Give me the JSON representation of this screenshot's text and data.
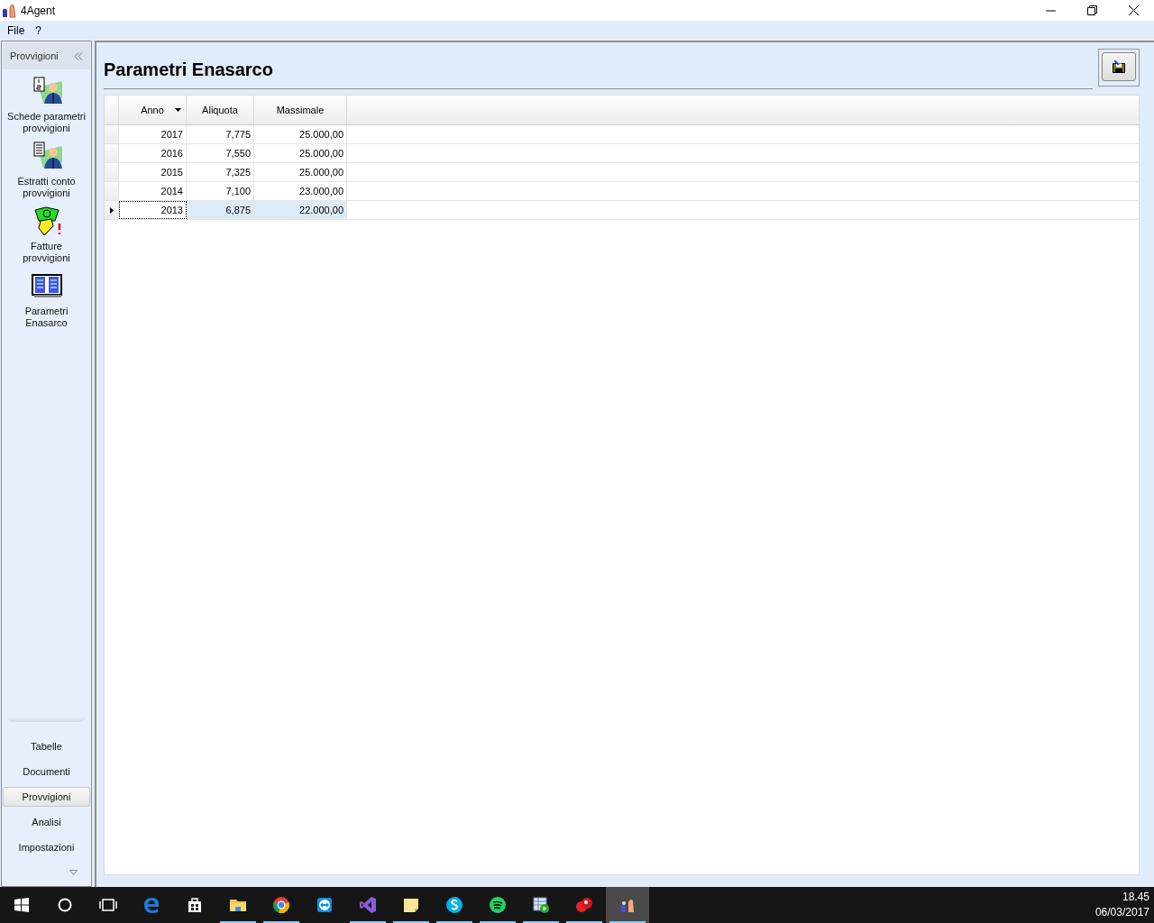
{
  "window": {
    "title": "4Agent"
  },
  "menu": [
    "File",
    "?"
  ],
  "sidebar": {
    "header": "Provvigioni",
    "items": [
      {
        "kind": "schede",
        "label": "Schede parametri provvigioni"
      },
      {
        "kind": "estratti",
        "label": "Estratti conto provvigioni"
      },
      {
        "kind": "fatture",
        "label": "Fatture provvigioni"
      },
      {
        "kind": "parametri",
        "label": "Parametri Enasarco"
      }
    ],
    "sections": [
      {
        "label": "Tabelle",
        "selected": false
      },
      {
        "label": "Documenti",
        "selected": false
      },
      {
        "label": "Provvigioni",
        "selected": true
      },
      {
        "label": "Analisi",
        "selected": false
      },
      {
        "label": "Impostazioni",
        "selected": false
      }
    ]
  },
  "page": {
    "title": "Parametri Enasarco"
  },
  "table": {
    "columns": [
      {
        "label": "Anno",
        "sorted": true
      },
      {
        "label": "Aliquota",
        "sorted": false
      },
      {
        "label": "Massimale",
        "sorted": false
      }
    ],
    "rows": [
      {
        "cells": [
          "2017",
          "7,775",
          "25.000,00"
        ],
        "selected": false
      },
      {
        "cells": [
          "2016",
          "7,550",
          "25.000,00"
        ],
        "selected": false
      },
      {
        "cells": [
          "2015",
          "7,325",
          "25.000,00"
        ],
        "selected": false
      },
      {
        "cells": [
          "2014",
          "7,100",
          "23.000,00"
        ],
        "selected": false
      },
      {
        "cells": [
          "2013",
          "6,875",
          "22.000,00"
        ],
        "selected": true
      }
    ]
  },
  "taskbar": {
    "apps": [
      {
        "kind": "windows",
        "running": false,
        "active": false
      },
      {
        "kind": "search",
        "running": false,
        "active": false
      },
      {
        "kind": "taskview",
        "running": false,
        "active": false
      },
      {
        "kind": "edge",
        "running": false,
        "active": false
      },
      {
        "kind": "store",
        "running": false,
        "active": false
      },
      {
        "kind": "folder",
        "running": true,
        "active": false
      },
      {
        "kind": "chrome",
        "running": true,
        "active": false
      },
      {
        "kind": "remote",
        "running": false,
        "active": false
      },
      {
        "kind": "vs",
        "running": true,
        "active": false
      },
      {
        "kind": "note",
        "running": true,
        "active": false
      },
      {
        "kind": "skype",
        "running": true,
        "active": false
      },
      {
        "kind": "spotify",
        "running": true,
        "active": false
      },
      {
        "kind": "player",
        "running": true,
        "active": false
      },
      {
        "kind": "red",
        "running": true,
        "active": false
      },
      {
        "kind": "agent",
        "running": true,
        "active": true
      }
    ],
    "time": "18.45",
    "date": "06/03/2017"
  }
}
